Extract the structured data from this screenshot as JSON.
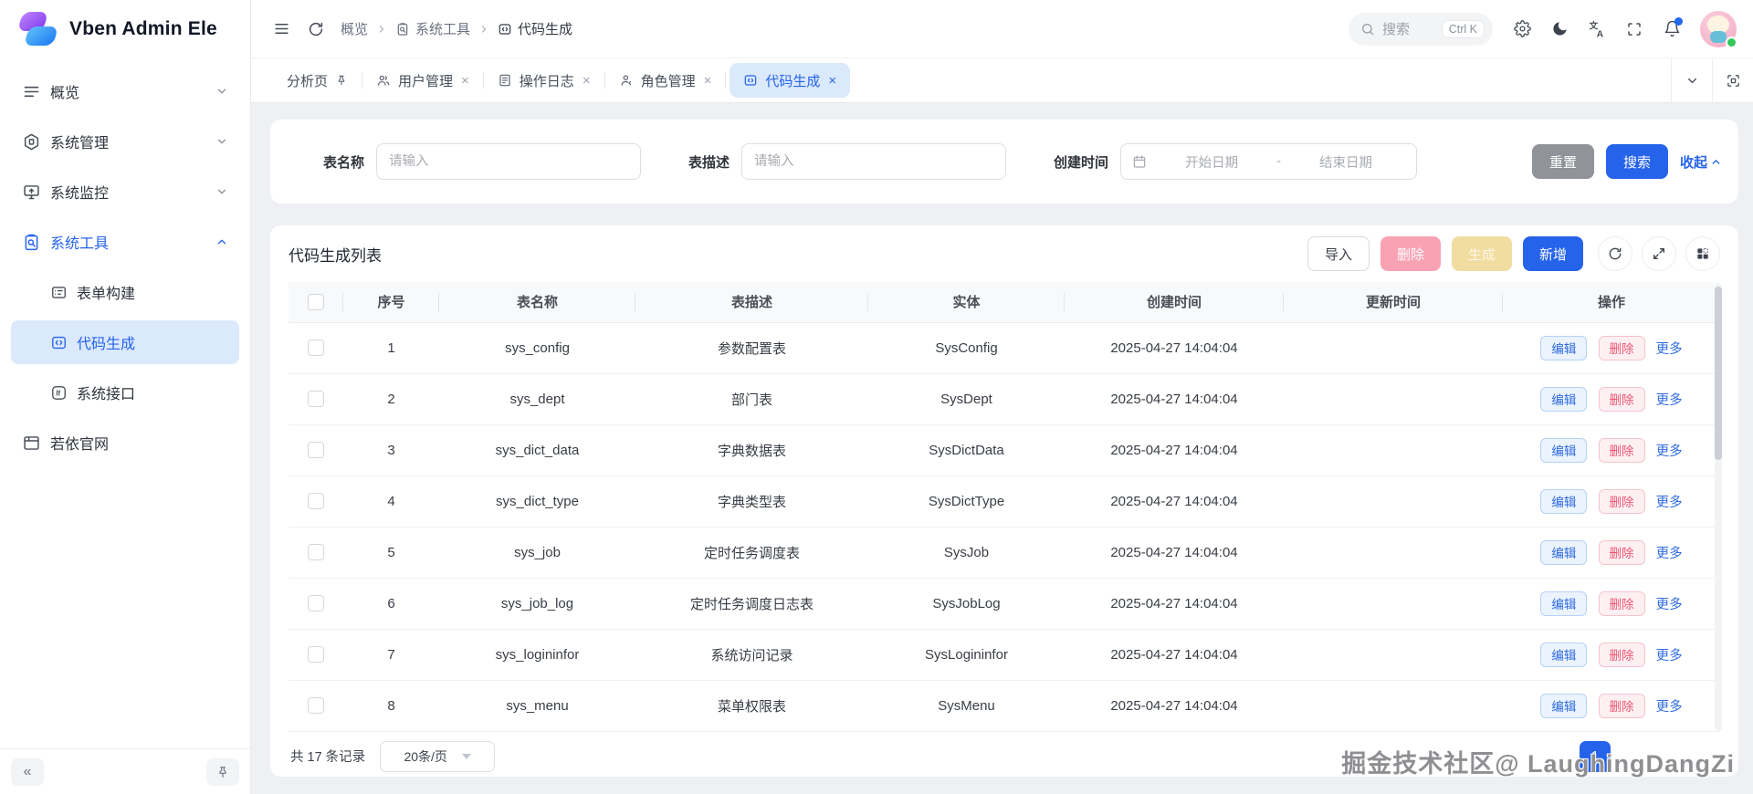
{
  "app": {
    "title": "Vben Admin Ele"
  },
  "sidebar": {
    "items": [
      {
        "label": "概览"
      },
      {
        "label": "系统管理"
      },
      {
        "label": "系统监控"
      },
      {
        "label": "系统工具",
        "children": [
          {
            "label": "表单构建"
          },
          {
            "label": "代码生成"
          },
          {
            "label": "系统接口"
          }
        ]
      },
      {
        "label": "若依官网"
      }
    ]
  },
  "header": {
    "breadcrumb": [
      "概览",
      "系统工具",
      "代码生成"
    ],
    "search_label": "搜索",
    "search_shortcut": "Ctrl K"
  },
  "tabs": {
    "items": [
      {
        "label": "分析页"
      },
      {
        "label": "用户管理"
      },
      {
        "label": "操作日志"
      },
      {
        "label": "角色管理"
      },
      {
        "label": "代码生成"
      }
    ]
  },
  "ui": {
    "close_glyph": "×",
    "collapse_glyph": "«"
  },
  "filter": {
    "name_label": "表名称",
    "name_placeholder": "请输入",
    "desc_label": "表描述",
    "desc_placeholder": "请输入",
    "time_label": "创建时间",
    "start_placeholder": "开始日期",
    "range_separator": "-",
    "end_placeholder": "结束日期",
    "reset": "重置",
    "search": "搜索",
    "collapse": "收起"
  },
  "table": {
    "title": "代码生成列表",
    "import": "导入",
    "delete": "删除",
    "generate": "生成",
    "add": "新增",
    "columns": [
      "序号",
      "表名称",
      "表描述",
      "实体",
      "创建时间",
      "更新时间",
      "操作"
    ],
    "actions": {
      "edit": "编辑",
      "delete": "删除",
      "more": "更多"
    },
    "rows": [
      {
        "index": "1",
        "table_name": "sys_config",
        "description": "参数配置表",
        "entity": "SysConfig",
        "created_at": "2025-04-27 14:04:04",
        "updated_at": ""
      },
      {
        "index": "2",
        "table_name": "sys_dept",
        "description": "部门表",
        "entity": "SysDept",
        "created_at": "2025-04-27 14:04:04",
        "updated_at": ""
      },
      {
        "index": "3",
        "table_name": "sys_dict_data",
        "description": "字典数据表",
        "entity": "SysDictData",
        "created_at": "2025-04-27 14:04:04",
        "updated_at": ""
      },
      {
        "index": "4",
        "table_name": "sys_dict_type",
        "description": "字典类型表",
        "entity": "SysDictType",
        "created_at": "2025-04-27 14:04:04",
        "updated_at": ""
      },
      {
        "index": "5",
        "table_name": "sys_job",
        "description": "定时任务调度表",
        "entity": "SysJob",
        "created_at": "2025-04-27 14:04:04",
        "updated_at": ""
      },
      {
        "index": "6",
        "table_name": "sys_job_log",
        "description": "定时任务调度日志表",
        "entity": "SysJobLog",
        "created_at": "2025-04-27 14:04:04",
        "updated_at": ""
      },
      {
        "index": "7",
        "table_name": "sys_logininfor",
        "description": "系统访问记录",
        "entity": "SysLogininfor",
        "created_at": "2025-04-27 14:04:04",
        "updated_at": ""
      },
      {
        "index": "8",
        "table_name": "sys_menu",
        "description": "菜单权限表",
        "entity": "SysMenu",
        "created_at": "2025-04-27 14:04:04",
        "updated_at": ""
      }
    ]
  },
  "pagination": {
    "total": "共 17 条记录",
    "page_size": "20条/页",
    "page": "1"
  },
  "watermark": "掘金技术社区@ LaughingDangZi",
  "colors": {
    "primary": "#2563eb",
    "primary_light": "#dbe9fd",
    "danger": "#ee5674",
    "danger_disabled": "#f9a2b4",
    "warning_disabled": "#f2dda1",
    "info_gray": "#909399",
    "success": "#35c75a",
    "notification_badge": "#2168f0"
  }
}
